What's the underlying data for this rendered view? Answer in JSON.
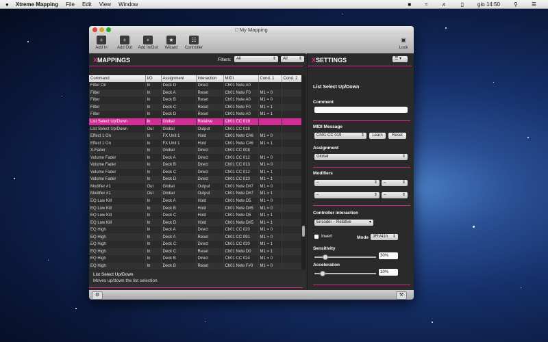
{
  "menubar": {
    "apple": "",
    "app_name": "Xtreme Mapping",
    "menus": [
      "File",
      "Edit",
      "View",
      "Window"
    ],
    "clock": "gio 14:50"
  },
  "window": {
    "title": "My Mapping",
    "toolbar": {
      "add_in": "Add In",
      "add_out": "Add Out",
      "add_inout": "Add In/Out",
      "wizard": "Wizard",
      "controller": "Controller",
      "lock": "Lock"
    }
  },
  "mappings": {
    "title_x": "X",
    "title_rest": "MAPPINGS",
    "filters_label": "Filters:",
    "filter1": "All",
    "filter2": "All",
    "columns": [
      "Command",
      "I/O",
      "Assignment",
      "Interaction",
      "MIDI",
      "Cond. 1",
      "Cond. 2"
    ],
    "rows": [
      [
        "Filter On",
        "In",
        "Deck D",
        "Direct",
        "Ch01 Note A0",
        "",
        ""
      ],
      [
        "Filter",
        "In",
        "Deck A",
        "Reset",
        "Ch01 Note F0",
        "M1 = 0",
        ""
      ],
      [
        "Filter",
        "In",
        "Deck B",
        "Reset",
        "Ch01 Note A0",
        "M1 = 0",
        ""
      ],
      [
        "Filter",
        "In",
        "Deck C",
        "Reset",
        "Ch01 Note F0",
        "M1 = 1",
        ""
      ],
      [
        "Filter",
        "In",
        "Deck D",
        "Reset",
        "Ch01 Note A0",
        "M1 = 1",
        ""
      ],
      [
        "List Select Up/Down",
        "In",
        "Global",
        "Relative",
        "Ch01 CC 019",
        "",
        ""
      ],
      [
        "List Select Up/Down",
        "Out",
        "Global",
        "Output",
        "Ch01 CC 018",
        "",
        ""
      ],
      [
        "Effect 1 On",
        "In",
        "FX Unit 1",
        "Hold",
        "Ch01 Note C#6",
        "M1 = 0",
        ""
      ],
      [
        "Effect 1 On",
        "In",
        "FX Unit 1",
        "Hold",
        "Ch01 Note C#6",
        "M1 = 1",
        ""
      ],
      [
        "X-Fader",
        "In",
        "Global",
        "Direct",
        "Ch01 CC 008",
        "",
        ""
      ],
      [
        "Volume Fader",
        "In",
        "Deck A",
        "Direct",
        "Ch01 CC 012",
        "M1 = 0",
        ""
      ],
      [
        "Volume Fader",
        "In",
        "Deck B",
        "Direct",
        "Ch01 CC 013",
        "M1 = 0",
        ""
      ],
      [
        "Volume Fader",
        "In",
        "Deck C",
        "Direct",
        "Ch01 CC 012",
        "M1 = 1",
        ""
      ],
      [
        "Volume Fader",
        "In",
        "Deck D",
        "Direct",
        "Ch01 CC 013",
        "M1 = 1",
        ""
      ],
      [
        "Modifier #1",
        "Out",
        "Global",
        "Output",
        "Ch01 Note D#7",
        "M1 = 0",
        ""
      ],
      [
        "Modifier #1",
        "Out",
        "Global",
        "Output",
        "Ch01 Note D#7",
        "M1 = 1",
        ""
      ],
      [
        "EQ Low Kill",
        "In",
        "Deck A",
        "Hold",
        "Ch01 Note D5",
        "M1 = 0",
        ""
      ],
      [
        "EQ Low Kill",
        "In",
        "Deck B",
        "Hold",
        "Ch01 Note D#5",
        "M1 = 0",
        ""
      ],
      [
        "EQ Low Kill",
        "In",
        "Deck C",
        "Hold",
        "Ch01 Note D5",
        "M1 = 1",
        ""
      ],
      [
        "EQ Low Kill",
        "In",
        "Deck D",
        "Hold",
        "Ch01 Note D#5",
        "M1 = 1",
        ""
      ],
      [
        "EQ High",
        "In",
        "Deck A",
        "Direct",
        "Ch01 CC 020",
        "M1 = 0",
        ""
      ],
      [
        "EQ High",
        "In",
        "Deck A",
        "Reset",
        "Ch01 CC 091",
        "M1 = 0",
        ""
      ],
      [
        "EQ High",
        "In",
        "Deck C",
        "Direct",
        "Ch01 CC 020",
        "M1 = 1",
        ""
      ],
      [
        "EQ High",
        "In",
        "Deck C",
        "Reset",
        "Ch01 Note D0",
        "M1 = 1",
        ""
      ],
      [
        "EQ High",
        "In",
        "Deck B",
        "Direct",
        "Ch01 CC 024",
        "M1 = 0",
        ""
      ],
      [
        "EQ High",
        "In",
        "Deck B",
        "Reset",
        "Ch01 Note F#0",
        "M1 = 0",
        ""
      ]
    ],
    "highlight_row": 5,
    "desc_title": "List Select Up/Down",
    "desc_text": "Moves up/down the list selection"
  },
  "settings": {
    "title_x": "X",
    "title_rest": "SETTINGS",
    "command": "List Select Up/Down",
    "comment_label": "Comment",
    "midi_label": "MIDI Message",
    "midi_value": "Ch01 CC 019",
    "learn": "Learn",
    "reset": "Reset",
    "assignment_label": "Assignment",
    "assignment_value": "Global",
    "modifiers_label": "Modifiers",
    "mod_value": "–",
    "ci_label": "Controller interaction",
    "ci_value": "Encoder – Relative",
    "invert": "Invert",
    "mode_label": "Mode",
    "mode_value": "3Fh/41h",
    "sensitivity_label": "Sensitivity",
    "sensitivity_value": "30%",
    "acceleration_label": "Acceleration",
    "acceleration_value": "10%"
  },
  "colors": {
    "accent": "#d9268c"
  }
}
